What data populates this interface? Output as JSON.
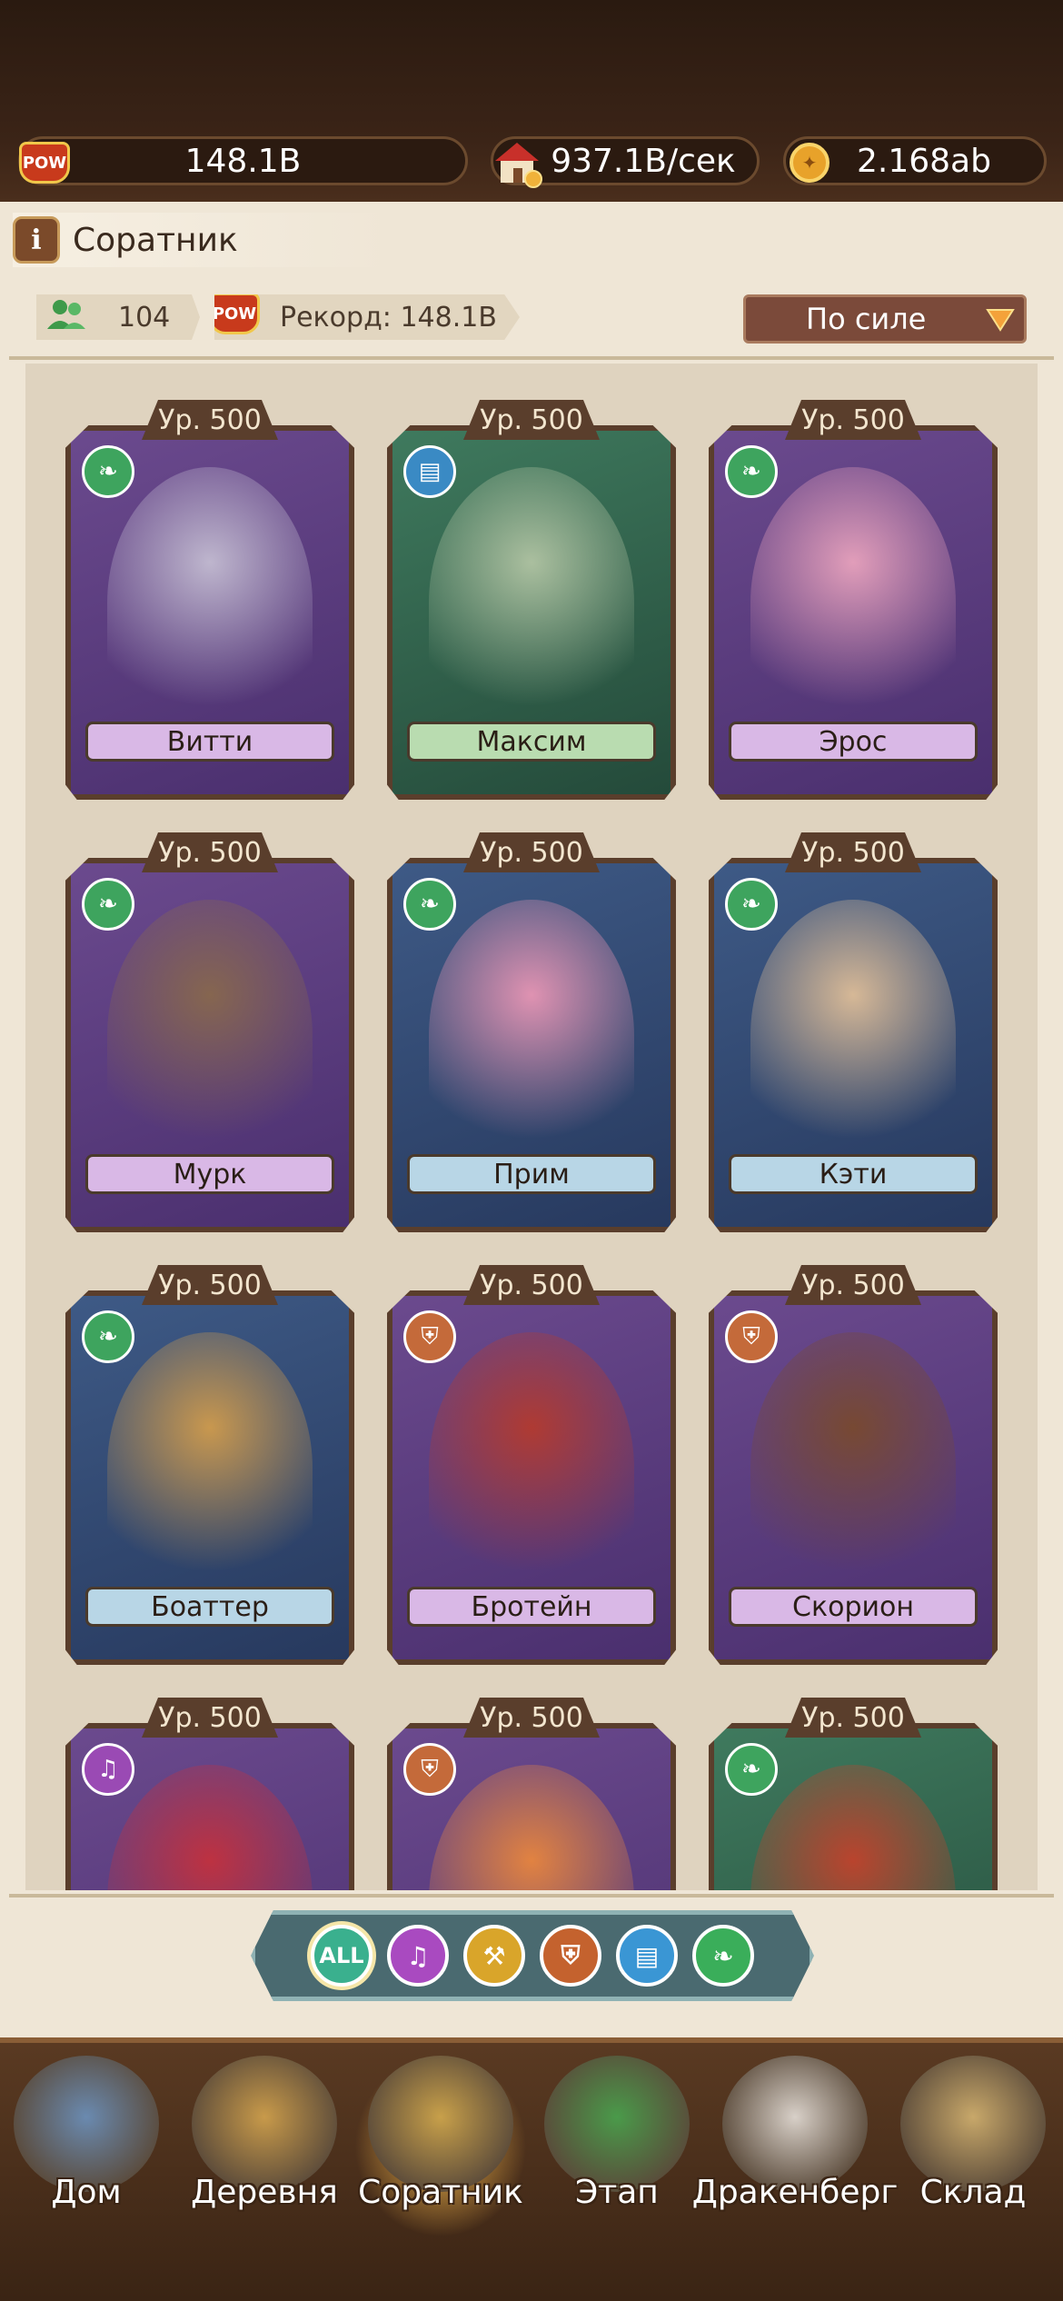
{
  "header": {
    "power_value": "148.1B",
    "income_value": "937.1B/сек",
    "gold_value": "2.168ab",
    "pow_label": "POW",
    "colors": {
      "bar_bg": "#2b1a10",
      "accent": "#c83a1c"
    }
  },
  "page": {
    "title": "Соратник",
    "companion_count": "104",
    "record_text": "Рекорд: 148.1B",
    "sort_label": "По силе"
  },
  "cards": [
    {
      "level": "Ур. 500",
      "name": "Витти",
      "class_icon": "wind-icon",
      "theme": "purple"
    },
    {
      "level": "Ур. 500",
      "name": "Максим",
      "class_icon": "book-icon",
      "theme": "green"
    },
    {
      "level": "Ур. 500",
      "name": "Эрос",
      "class_icon": "wind-icon",
      "theme": "purple"
    },
    {
      "level": "Ур. 500",
      "name": "Мурк",
      "class_icon": "wind-icon",
      "theme": "purple"
    },
    {
      "level": "Ур. 500",
      "name": "Прим",
      "class_icon": "wind-icon",
      "theme": "blue"
    },
    {
      "level": "Ур. 500",
      "name": "Кэти",
      "class_icon": "wind-icon",
      "theme": "blue"
    },
    {
      "level": "Ур. 500",
      "name": "Боаттер",
      "class_icon": "wind-icon",
      "theme": "blue"
    },
    {
      "level": "Ур. 500",
      "name": "Бротейн",
      "class_icon": "sword-icon",
      "theme": "purple"
    },
    {
      "level": "Ур. 500",
      "name": "Скорион",
      "class_icon": "sword-icon",
      "theme": "purple"
    },
    {
      "level": "Ур. 500",
      "name": "",
      "class_icon": "harp-icon",
      "theme": "purple"
    },
    {
      "level": "Ур. 500",
      "name": "",
      "class_icon": "sword-icon",
      "theme": "purple"
    },
    {
      "level": "Ур. 500",
      "name": "",
      "class_icon": "wind-icon",
      "theme": "green"
    }
  ],
  "filters": {
    "all_label": "ALL",
    "icons": [
      "harp-icon",
      "broom-icon",
      "sword-icon",
      "book-icon",
      "wind-icon"
    ]
  },
  "nav": [
    {
      "label": "Дом",
      "icon": "home-icon",
      "active": false
    },
    {
      "label": "Деревня",
      "icon": "village-icon",
      "active": false
    },
    {
      "label": "Соратник",
      "icon": "companion-icon",
      "active": true
    },
    {
      "label": "Этап",
      "icon": "stage-icon",
      "active": false
    },
    {
      "label": "Дракенберг",
      "icon": "drakenberg-icon",
      "active": false
    },
    {
      "label": "Склад",
      "icon": "storage-icon",
      "active": false
    }
  ]
}
